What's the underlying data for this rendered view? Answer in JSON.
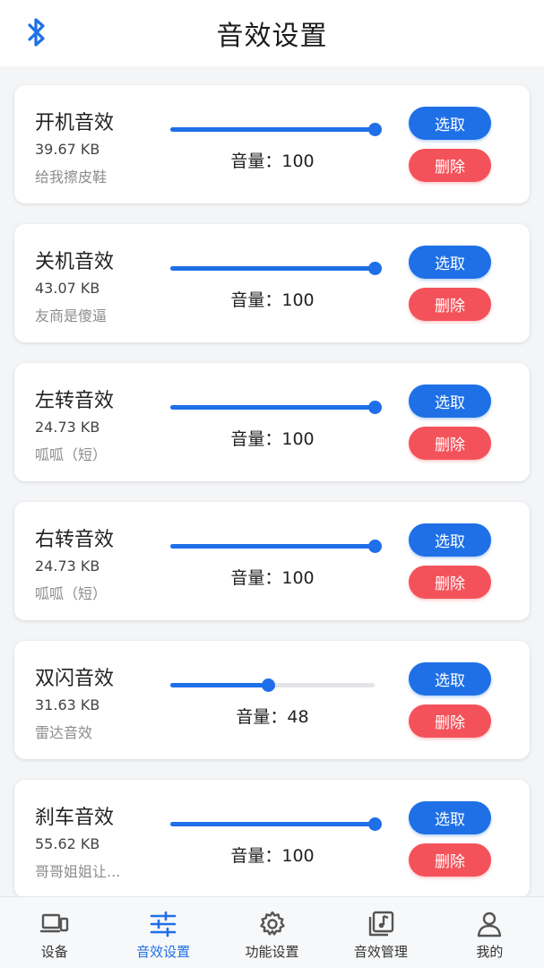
{
  "header": {
    "title": "音效设置",
    "bluetooth_icon": "bluetooth-icon"
  },
  "colors": {
    "accent": "#1e6fe8",
    "danger": "#f4525a",
    "background": "#f4f5f7"
  },
  "buttons": {
    "select_label": "选取",
    "delete_label": "删除"
  },
  "volume_prefix": "音量：",
  "sounds": [
    {
      "name": "开机音效",
      "size": "39.67 KB",
      "desc": "给我擦皮鞋",
      "volume": 100,
      "volume_text": "100"
    },
    {
      "name": "关机音效",
      "size": "43.07 KB",
      "desc": "友商是傻逼",
      "volume": 100,
      "volume_text": "100"
    },
    {
      "name": "左转音效",
      "size": "24.73 KB",
      "desc": "呱呱（短）",
      "volume": 100,
      "volume_text": "100"
    },
    {
      "name": "右转音效",
      "size": "24.73 KB",
      "desc": "呱呱（短）",
      "volume": 100,
      "volume_text": "100"
    },
    {
      "name": "双闪音效",
      "size": "31.63 KB",
      "desc": "雷达音效",
      "volume": 48,
      "volume_text": "48"
    },
    {
      "name": "刹车音效",
      "size": "55.62 KB",
      "desc": "哥哥姐姐让...",
      "volume": 100,
      "volume_text": "100"
    }
  ],
  "tabs": [
    {
      "label": "设备",
      "icon": "device-icon",
      "active": false
    },
    {
      "label": "音效设置",
      "icon": "sliders-icon",
      "active": true
    },
    {
      "label": "功能设置",
      "icon": "gear-icon",
      "active": false
    },
    {
      "label": "音效管理",
      "icon": "music-folder-icon",
      "active": false
    },
    {
      "label": "我的",
      "icon": "user-icon",
      "active": false
    }
  ]
}
